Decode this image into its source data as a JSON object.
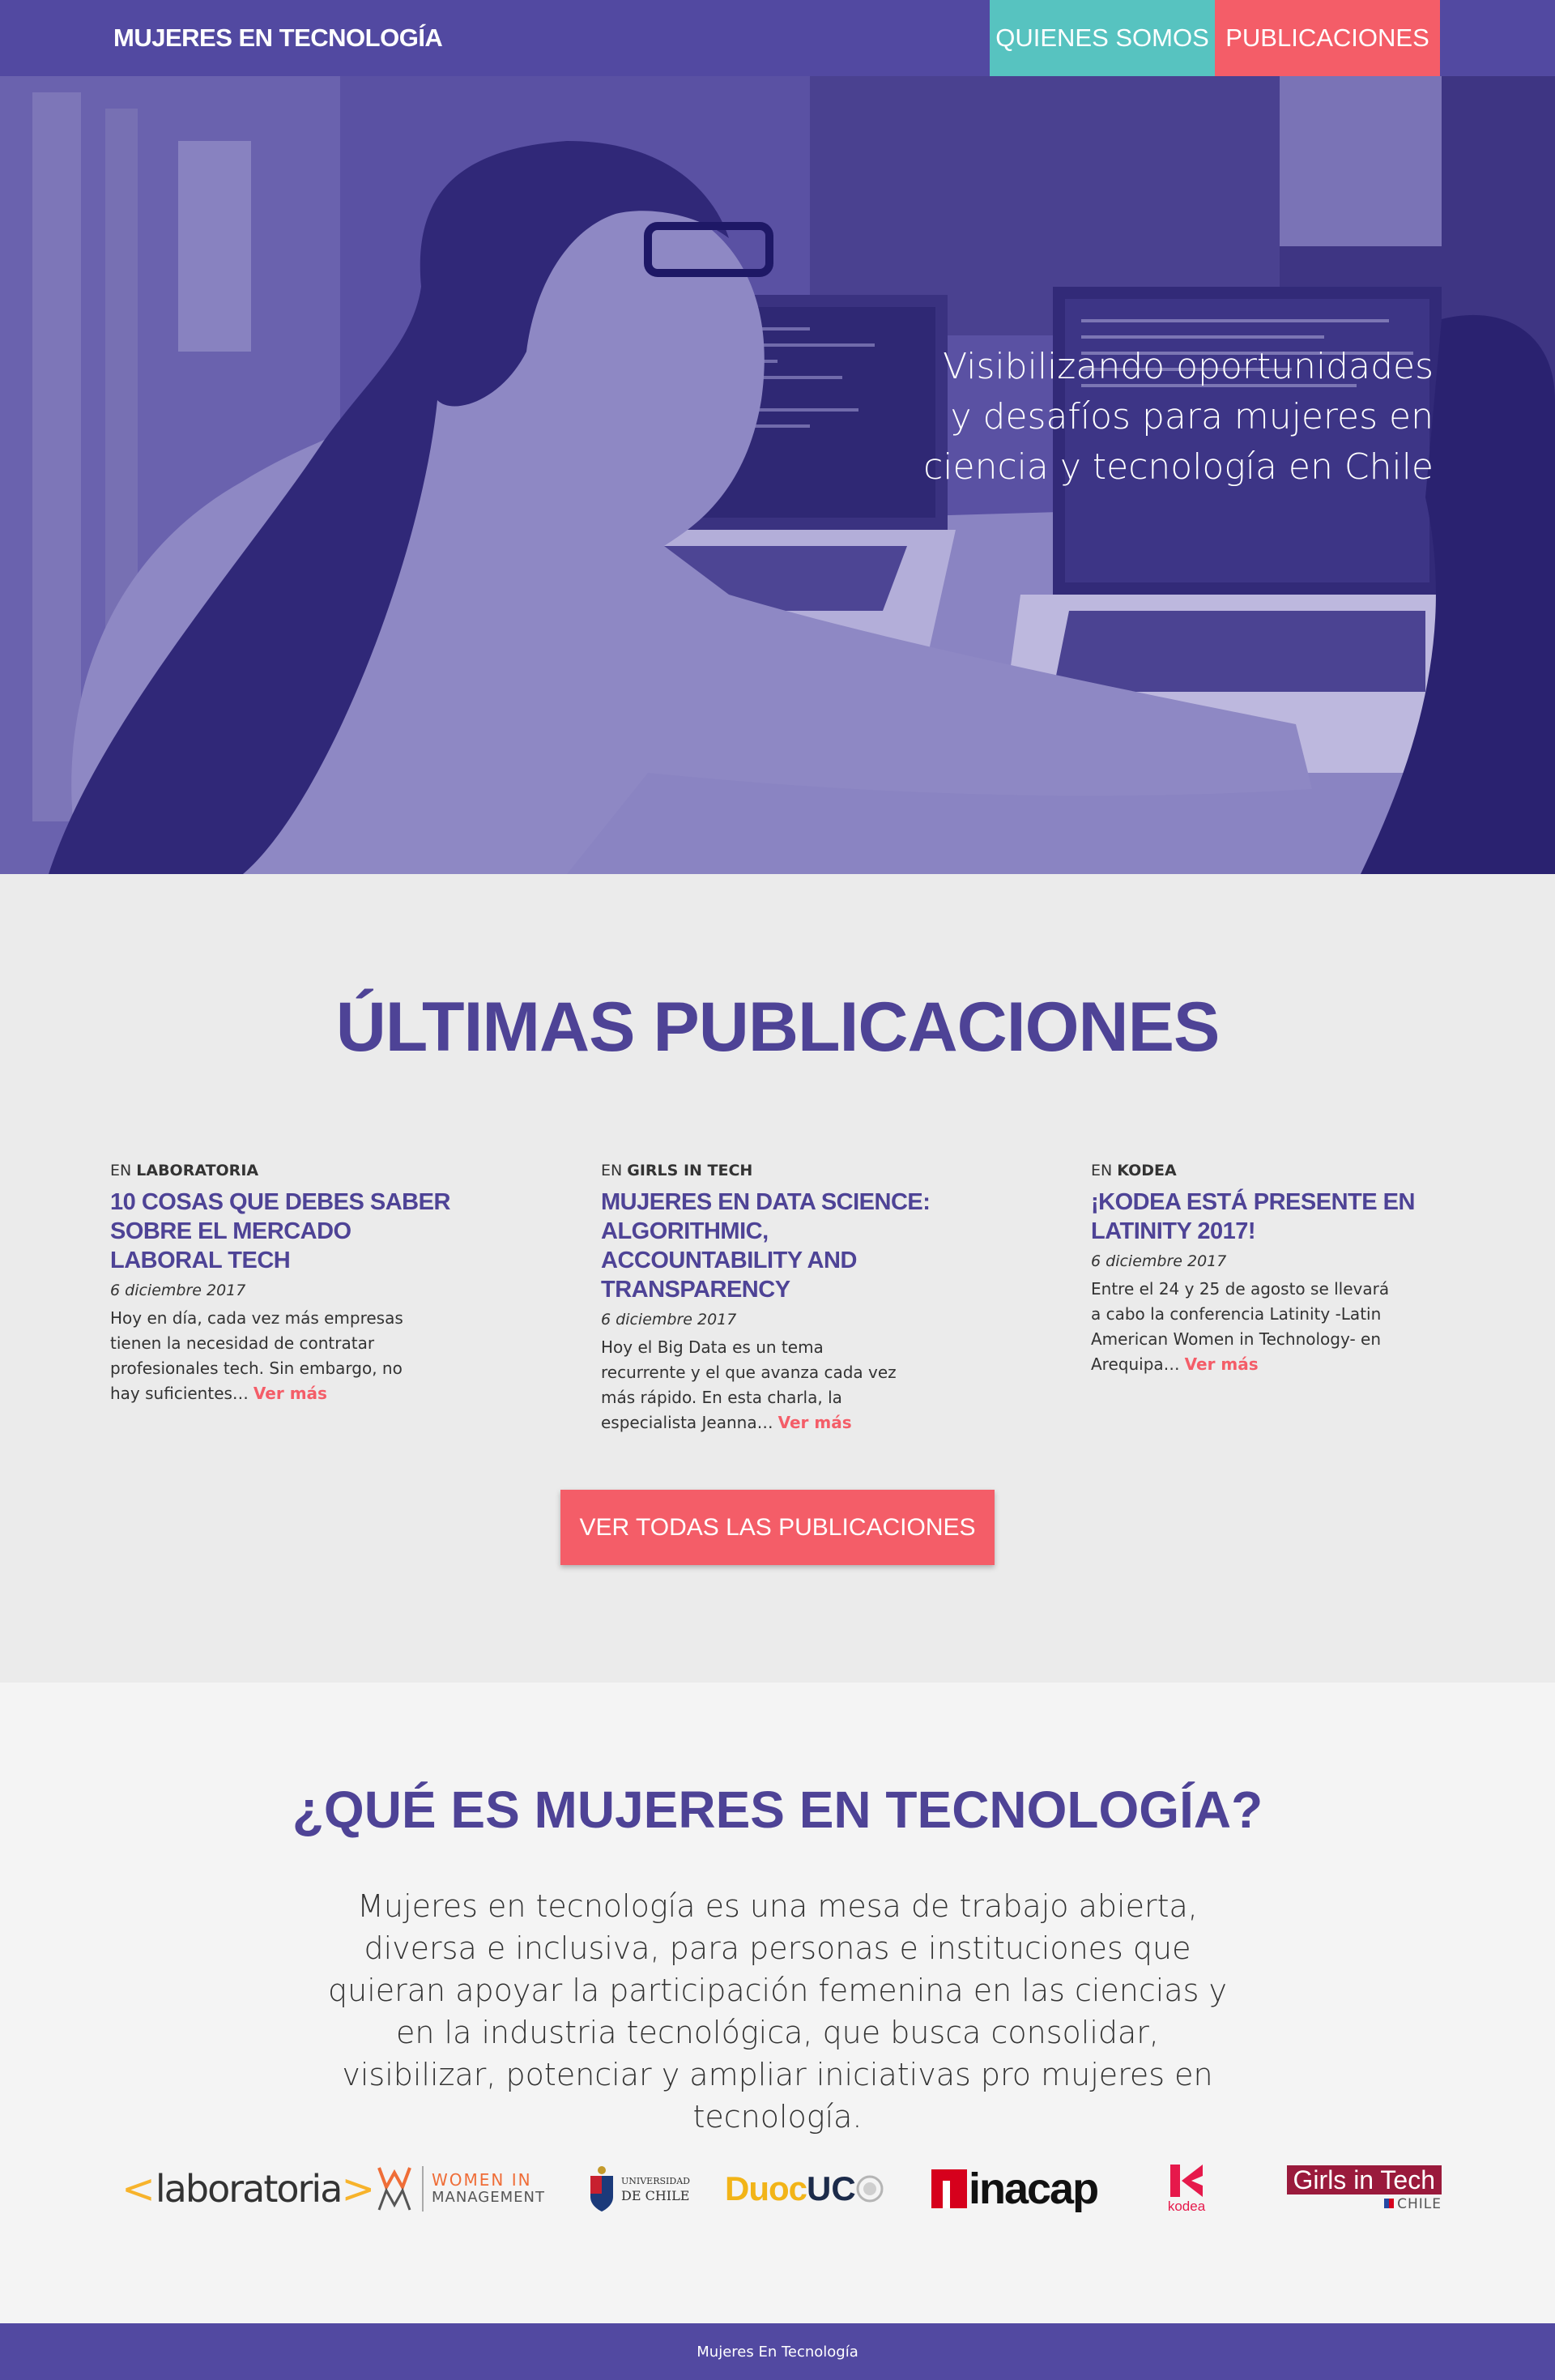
{
  "nav": {
    "brand": "MUJERES EN TECNOLOGÍA",
    "about_label": "QUIENES SOMOS",
    "publications_label": "PUBLICACIONES"
  },
  "hero": {
    "tagline": "Visibilizando oportunidades y desafíos para mujeres en ciencia y tecnología en Chile"
  },
  "latest": {
    "title": "ÚLTIMAS PUBLICACIONES",
    "cat_prefix": "EN",
    "read_more": "Ver más",
    "all_button": "VER TODAS LAS PUBLICACIONES",
    "posts": [
      {
        "category": "LABORATORIA",
        "title": "10 COSAS QUE DEBES SABER SOBRE EL MERCADO LABORAL TECH",
        "date": "6 diciembre 2017",
        "excerpt": "Hoy en día, cada vez más empresas tienen la necesidad de contratar profesionales tech. Sin embargo, no hay suficientes…"
      },
      {
        "category": "GIRLS IN TECH",
        "title": "MUJERES EN DATA SCIENCE: ALGORITHMIC, ACCOUNTABILITY AND TRANSPARENCY",
        "date": "6 diciembre 2017",
        "excerpt": "Hoy el Big Data es un tema recurrente y el que avanza cada vez más rápido. En esta charla, la especialista Jeanna…"
      },
      {
        "category": "KODEA",
        "title": "¡KODEA ESTÁ PRESENTE EN LATINITY 2017!",
        "date": "6 diciembre 2017",
        "excerpt": "Entre el 24 y 25 de agosto se llevará a cabo la conferencia Latinity -Latin American Women in Technology- en Arequipa…"
      }
    ]
  },
  "about": {
    "title_open": "¿",
    "title_que": "QUÉ",
    "title_es": " ES ",
    "title_mujeres": "MUJERES",
    "title_en": " EN ",
    "title_tecnologia": "TECNOLOGÍA",
    "title_close": "?",
    "text": "Mujeres en tecnología es una mesa de trabajo abierta, diversa e inclusiva, para personas e instituciones que quieran apoyar la participación femenina en las ciencias y en la industria tecnológica, que busca consolidar, visibilizar, potenciar y ampliar iniciativas pro mujeres en tecnología."
  },
  "partners": {
    "laboratoria": "laboratoria",
    "wim_line1": "WOMEN IN",
    "wim_line2": "MANAGEMENT",
    "uchile_line1": "UNIVERSIDAD",
    "uchile_line2": "DE CHILE",
    "duoc_a": "Duoc",
    "duoc_b": "UC",
    "inacap": "inacap",
    "kodea": "kodea",
    "git_line1": "Girls in Tech",
    "git_line2": "CHILE"
  },
  "footer": {
    "text": "Mujeres En Tecnología"
  },
  "colors": {
    "primary": "#5249a1",
    "teal": "#57c3c0",
    "coral": "#f45d68",
    "title_purple": "#4e4396"
  }
}
